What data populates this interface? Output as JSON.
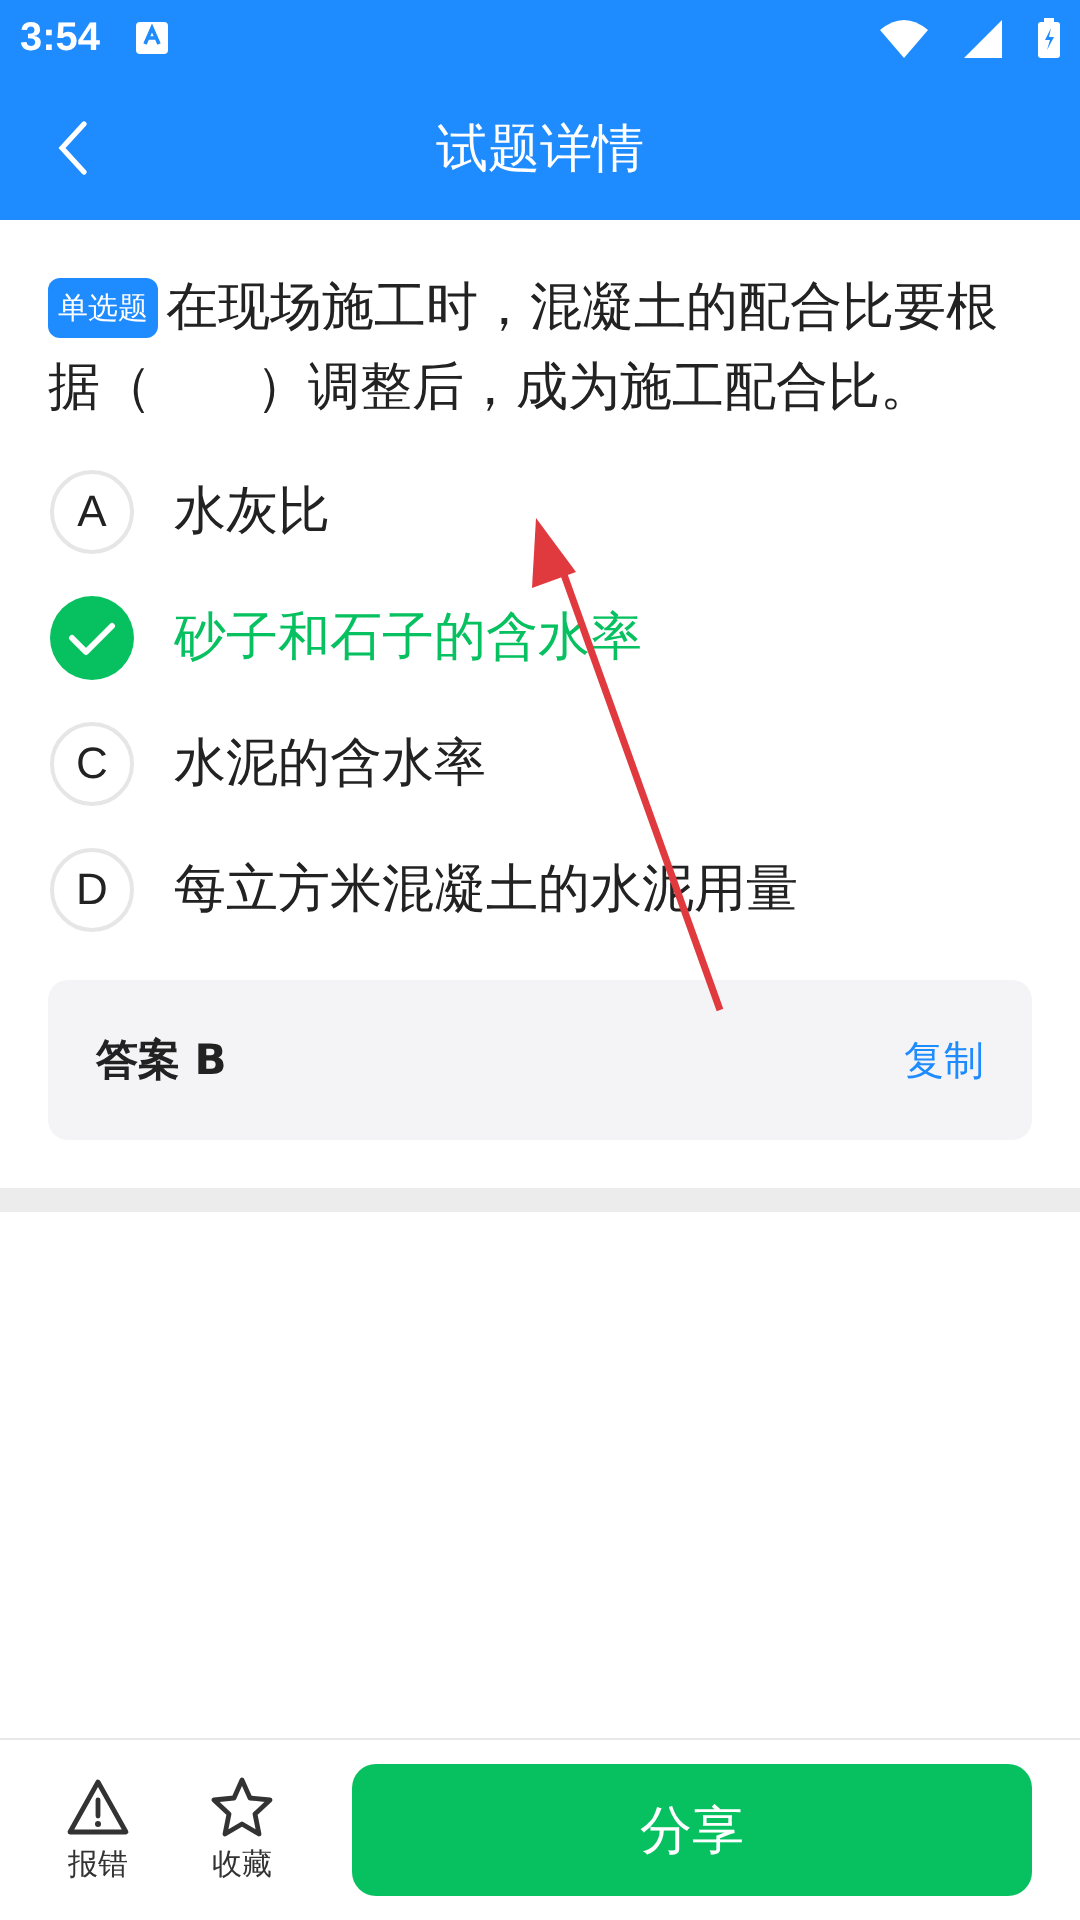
{
  "status_bar": {
    "time": "3:54"
  },
  "header": {
    "title": "试题详情"
  },
  "question": {
    "type_badge": "单选题",
    "text": "在现场施工时，混凝土的配合比要根据（　　）调整后，成为施工配合比。"
  },
  "options": [
    {
      "letter": "A",
      "text": "水灰比",
      "selected": false
    },
    {
      "text": "砂子和石子的含水率",
      "selected": true
    },
    {
      "letter": "C",
      "text": "水泥的含水率",
      "selected": false
    },
    {
      "letter": "D",
      "text": "每立方米混凝土的水泥用量",
      "selected": false
    }
  ],
  "answer": {
    "label": "答案 B",
    "copy": "复制"
  },
  "bottom_bar": {
    "actions": [
      {
        "kind": "report",
        "label": "报错"
      },
      {
        "kind": "favorite",
        "label": "收藏"
      }
    ],
    "share": "分享"
  }
}
